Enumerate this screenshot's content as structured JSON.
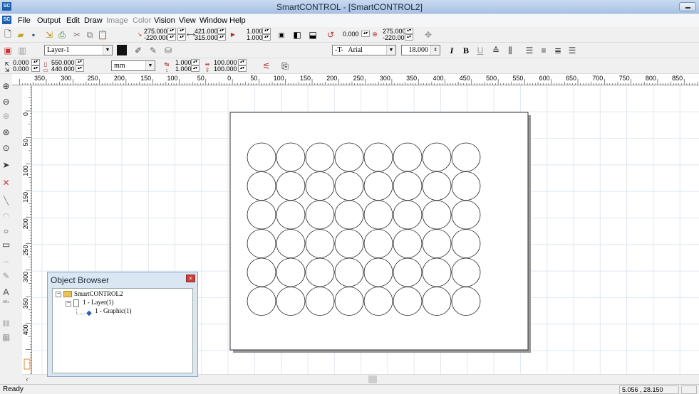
{
  "window": {
    "title": "SmartCONTROL - [SmartCONTROL2]",
    "logo_text": "SC"
  },
  "menu": {
    "items": [
      {
        "label": "File",
        "enabled": true
      },
      {
        "label": "Output",
        "enabled": true
      },
      {
        "label": "Edit",
        "enabled": true
      },
      {
        "label": "Draw",
        "enabled": true
      },
      {
        "label": "Image",
        "enabled": false
      },
      {
        "label": "Color",
        "enabled": false
      },
      {
        "label": "Vision",
        "enabled": true
      },
      {
        "label": "View",
        "enabled": true
      },
      {
        "label": "Window",
        "enabled": true
      },
      {
        "label": "Help",
        "enabled": true
      }
    ]
  },
  "toolbar1": {
    "pos_x": "275.000",
    "pos_y": "-220.000",
    "width": "421.000",
    "height": "315.000",
    "scale_x": "1.000",
    "scale_y": "1.000",
    "rotation": "0.000",
    "center_x": "275.000",
    "center_y": "-220.000"
  },
  "toolbar2": {
    "layer": "Layer-1",
    "font_prefix": "-T-",
    "font": "Arial",
    "font_size": "18.000",
    "italic": "I",
    "bold": "B",
    "underline": "U"
  },
  "toolbar3": {
    "origin_x": "0.000",
    "origin_y": "0.000",
    "page_w": "550.000",
    "page_h": "440.000",
    "unit": "mm",
    "step_x": "1.000",
    "step_y": "1.000",
    "zoom_x": "100.000",
    "zoom_y": "100.000"
  },
  "ruler": {
    "h_labels": [
      "350",
      "300",
      "250",
      "200",
      "150",
      "100",
      "50",
      "0",
      "50",
      "100",
      "150",
      "200",
      "250",
      "300",
      "350",
      "400",
      "450",
      "500",
      "550",
      "600",
      "650",
      "700",
      "750",
      "800",
      "850"
    ],
    "v_labels": [
      "0",
      "50",
      "100",
      "150",
      "200",
      "250",
      "300",
      "350",
      "400"
    ]
  },
  "drawing": {
    "rows": 6,
    "cols": 8
  },
  "object_browser": {
    "title": "Object Browser",
    "close_label": "×",
    "tree": {
      "root": "SmartCONTROL2",
      "layer": "1 - Layer(1)",
      "graphic": "1 - Graphic(1)"
    }
  },
  "status": {
    "left": "Ready",
    "coords": "5.056 , 28.150"
  }
}
